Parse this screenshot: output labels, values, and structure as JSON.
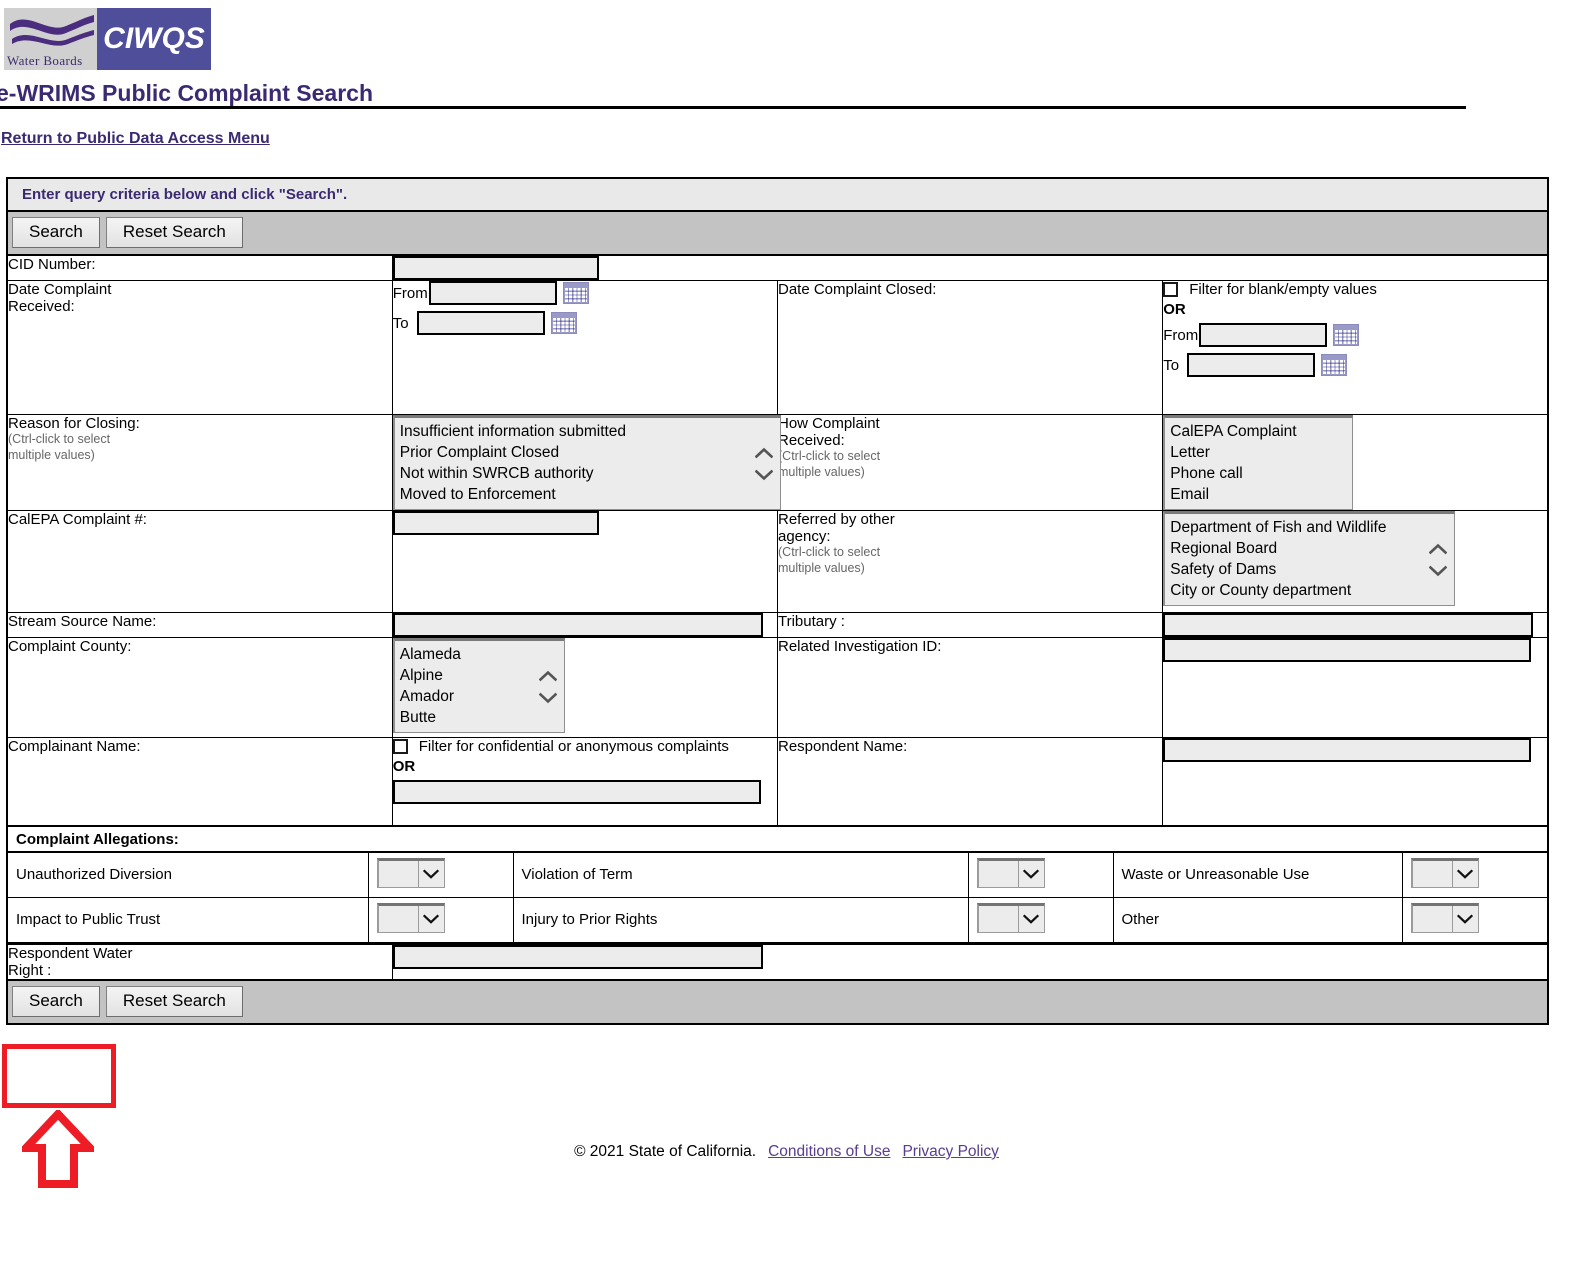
{
  "branding": {
    "logo_left_text": "Water Boards",
    "logo_right_text": "CIWQS",
    "logo_purple": "#4e4e9a",
    "logo_gray": "#d0d0d0"
  },
  "header": {
    "page_title": "e-WRIMS Public Complaint Search",
    "title_color": "#3b2a72",
    "return_link": "Return to Public Data Access Menu"
  },
  "form": {
    "banner": "Enter query criteria below and click \"Search\".",
    "search_label": "Search",
    "reset_label": "Reset Search",
    "ctrl_hint_line1": "(Ctrl-click to select",
    "ctrl_hint_line2": "multiple values)",
    "or_label": "OR",
    "from_label": "From",
    "to_label": "To",
    "fields": {
      "cid_number": "CID Number:",
      "date_received": "Date Complaint Received:",
      "date_received_line1": "Date Complaint",
      "date_received_line2": "Received:",
      "date_closed": "Date Complaint Closed:",
      "date_closed_blank_filter": "Filter for blank/empty values",
      "reason_for_closing": "Reason for Closing:",
      "how_received_line1": "How Complaint",
      "how_received_line2": "Received:",
      "calepa_number": "CalEPA Complaint #:",
      "referred_line1": "Referred by other",
      "referred_line2": "agency:",
      "stream_source": "Stream Source Name:",
      "tributary": "Tributary :",
      "complaint_county": "Complaint County:",
      "related_investigation": "Related Investigation ID:",
      "complainant_name": "Complainant Name:",
      "complainant_confidential_filter": "Filter for confidential or anonymous complaints",
      "respondent_name": "Respondent Name:",
      "respondent_water_right_line1": "Respondent Water",
      "respondent_water_right_line2": "Right :"
    },
    "values": {
      "cid_number": "",
      "date_received_from": "",
      "date_received_to": "",
      "date_closed_from": "",
      "date_closed_to": "",
      "calepa_number": "",
      "stream_source": "",
      "tributary": "",
      "related_investigation": "",
      "complainant_name": "",
      "respondent_name": "",
      "respondent_water_right": ""
    },
    "listboxes": {
      "reason_for_closing": [
        "Insufficient information submitted",
        "Prior Complaint Closed",
        "Not within SWRCB authority",
        "Moved to Enforcement"
      ],
      "how_received": [
        "CalEPA Complaint",
        "Letter",
        "Phone call",
        "Email"
      ],
      "referred_by_agency": [
        "Department of Fish and Wildlife",
        "Regional Board",
        "Safety of Dams",
        "City or County department"
      ],
      "complaint_county": [
        "Alameda",
        "Alpine",
        "Amador",
        "Butte"
      ]
    },
    "allegations": {
      "section_label": "Complaint Allegations:",
      "rows": [
        [
          {
            "label": "Unauthorized Diversion",
            "value": ""
          },
          {
            "label": "Violation of Term",
            "value": ""
          },
          {
            "label": "Waste or Unreasonable Use",
            "value": ""
          }
        ],
        [
          {
            "label": "Impact to Public Trust",
            "value": ""
          },
          {
            "label": "Injury to Prior Rights",
            "value": ""
          },
          {
            "label": "Other",
            "value": ""
          }
        ]
      ]
    }
  },
  "annotation": {
    "highlight_color": "#ee1c25",
    "target": "Search"
  },
  "footer": {
    "copyright": "© 2021 State of California.",
    "conditions_link": "Conditions of Use",
    "privacy_link": "Privacy Policy"
  }
}
